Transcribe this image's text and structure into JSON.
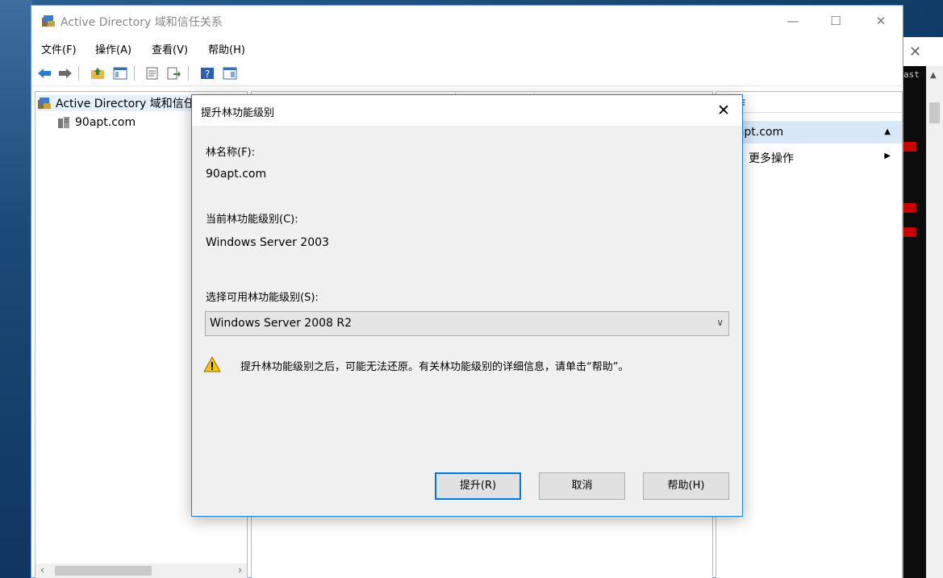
{
  "window": {
    "title": "Active Directory 域和信任关系",
    "minimize": "—",
    "maximize": "☐",
    "close": "✕"
  },
  "menu": [
    "文件(F)",
    "操作(A)",
    "查看(V)",
    "帮助(H)"
  ],
  "tree": {
    "root": "Active Directory 域和信任关系",
    "child": "90apt.com"
  },
  "actions": {
    "header": "操作",
    "group": "90apt.com",
    "more": "更多操作"
  },
  "background": {
    "cmd_text": "ast",
    "close": "✕"
  },
  "dialog": {
    "title": "提升林功能级别",
    "close": "✕",
    "forest_name_label": "林名称(F):",
    "forest_name_value": "90apt.com",
    "current_level_label": "当前林功能级别(C):",
    "current_level_value": "Windows Server 2003",
    "select_label": "选择可用林功能级别(S):",
    "select_value": "Windows Server 2008 R2",
    "warning": "提升林功能级别之后，可能无法还原。有关林功能级别的详细信息，请单击“帮助”。",
    "buttons": {
      "raise": "提升(R)",
      "cancel": "取消",
      "help": "帮助(H)"
    }
  },
  "icons": [
    "back-icon",
    "forward-icon",
    "up-folder-icon",
    "console-tree-icon",
    "properties-icon",
    "export-icon",
    "help-icon",
    "mmc-view-icon",
    "warning-icon",
    "server-icon",
    "chevron-down-icon"
  ],
  "colors": {
    "accent": "#0078d7",
    "selection": "#d9e8f7",
    "warning": "#f7c600"
  }
}
